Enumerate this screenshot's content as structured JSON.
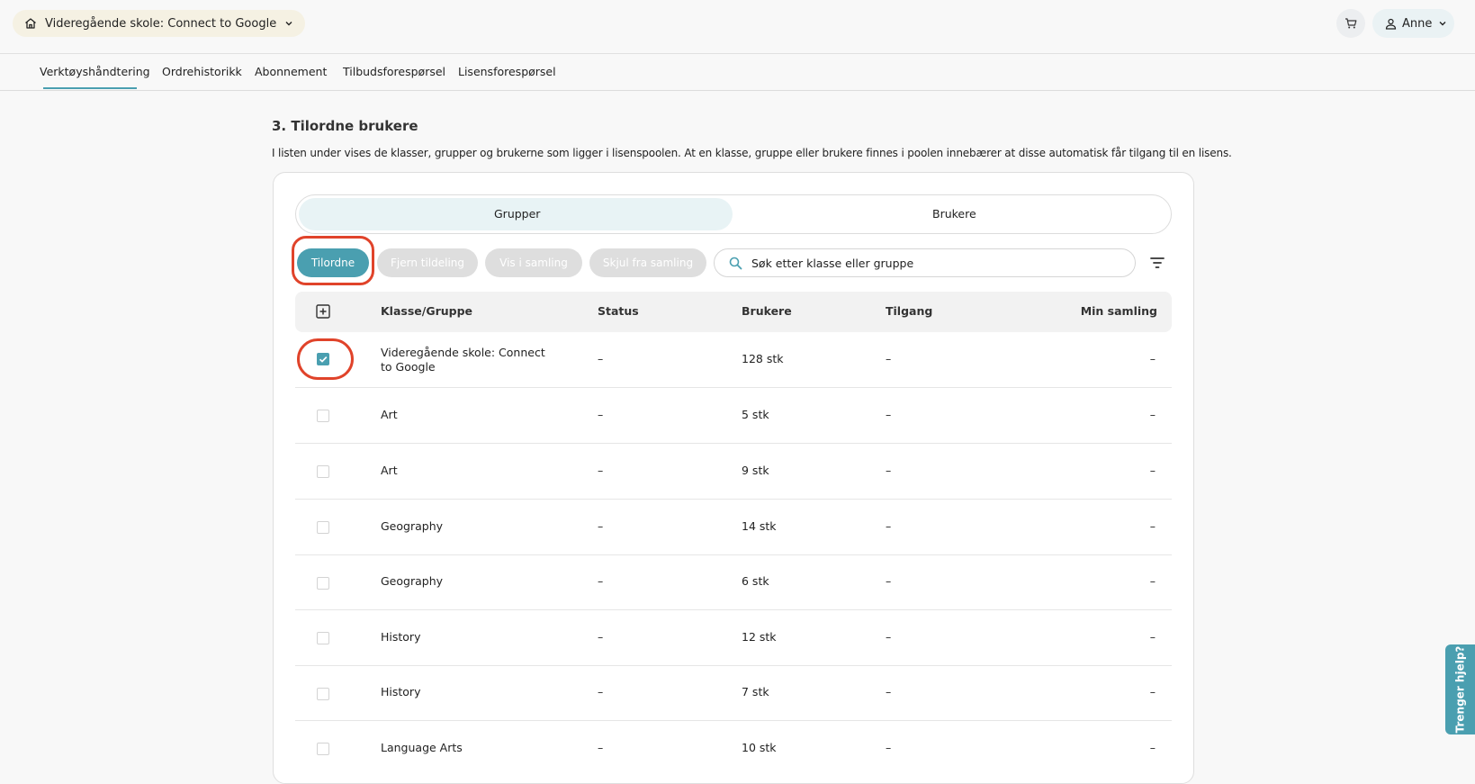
{
  "header": {
    "org_name": "Videregående skole: Connect to Google",
    "user_name": "Anne"
  },
  "nav": {
    "tabs": [
      {
        "label": "Verktøyshåndtering",
        "active": true
      },
      {
        "label": "Ordrehistorikk"
      },
      {
        "label": "Abonnement"
      },
      {
        "label": "Tilbudsforespørsel"
      },
      {
        "label": "Lisensforespørsel"
      }
    ]
  },
  "section": {
    "title": "3. Tilordne brukere",
    "description": "I listen under vises de klasser, grupper og brukerne som ligger i lisenspoolen. At en klasse, gruppe eller brukere finnes i poolen innebærer at disse automatisk får tilgang til en lisens."
  },
  "segmented": {
    "options": [
      {
        "label": "Grupper",
        "active": true
      },
      {
        "label": "Brukere",
        "active": false
      }
    ]
  },
  "actions": {
    "assign": "Tilordne",
    "remove": "Fjern tildeling",
    "show": "Vis i samling",
    "hide": "Skjul fra samling"
  },
  "search": {
    "placeholder": "Søk etter klasse eller gruppe"
  },
  "table": {
    "columns": [
      "Klasse/Gruppe",
      "Status",
      "Brukere",
      "Tilgang",
      "Min samling"
    ],
    "rows": [
      {
        "name": "Videregående skole: Connect to Google",
        "status": "–",
        "users": "128 stk",
        "access": "–",
        "collection": "–",
        "checked": true
      },
      {
        "name": "Art",
        "status": "–",
        "users": "5 stk",
        "access": "–",
        "collection": "–",
        "checked": false
      },
      {
        "name": "Art",
        "status": "–",
        "users": "9 stk",
        "access": "–",
        "collection": "–",
        "checked": false
      },
      {
        "name": "Geography",
        "status": "–",
        "users": "14 stk",
        "access": "–",
        "collection": "–",
        "checked": false
      },
      {
        "name": "Geography",
        "status": "–",
        "users": "6 stk",
        "access": "–",
        "collection": "–",
        "checked": false
      },
      {
        "name": "History",
        "status": "–",
        "users": "12 stk",
        "access": "–",
        "collection": "–",
        "checked": false
      },
      {
        "name": "History",
        "status": "–",
        "users": "7 stk",
        "access": "–",
        "collection": "–",
        "checked": false
      },
      {
        "name": "Language Arts",
        "status": "–",
        "users": "10 stk",
        "access": "–",
        "collection": "–",
        "checked": false
      }
    ]
  },
  "help": {
    "label": "Trenger hjelp?"
  },
  "colors": {
    "accent": "#4a9fb0",
    "highlight": "#e0432a"
  }
}
